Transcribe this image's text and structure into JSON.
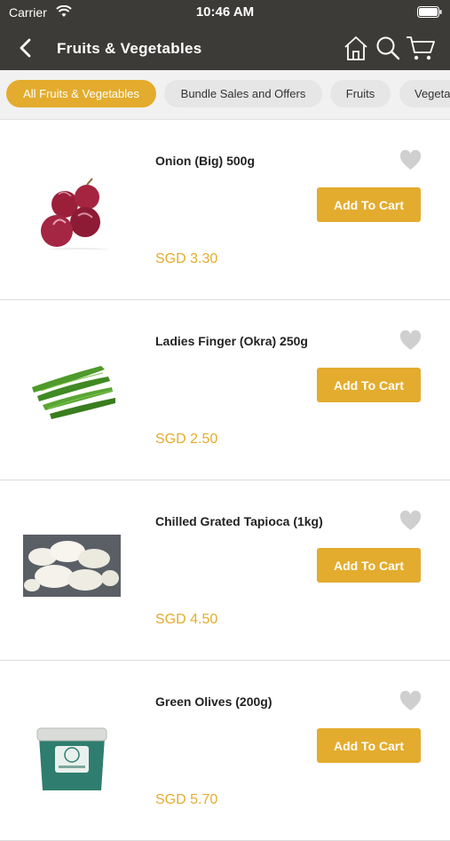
{
  "status_bar": {
    "carrier": "Carrier",
    "time": "10:46 AM"
  },
  "nav": {
    "title": "Fruits & Vegetables"
  },
  "categories": [
    {
      "label": "All Fruits & Vegetables",
      "active": true
    },
    {
      "label": "Bundle Sales and Offers",
      "active": false
    },
    {
      "label": "Fruits",
      "active": false
    },
    {
      "label": "Vegeta",
      "active": false
    }
  ],
  "products": [
    {
      "name": "Onion (Big) 500g",
      "price": "SGD 3.30",
      "button": "Add To Cart",
      "image": "onion"
    },
    {
      "name": "Ladies Finger (Okra) 250g",
      "price": "SGD 2.50",
      "button": "Add To Cart",
      "image": "okra"
    },
    {
      "name": "Chilled Grated Tapioca (1kg)",
      "price": "SGD 4.50",
      "button": "Add To Cart",
      "image": "tapioca"
    },
    {
      "name": "Green Olives (200g)",
      "price": "SGD 5.70",
      "button": "Add To Cart",
      "image": "olives-tub"
    }
  ],
  "colors": {
    "accent": "#e3ac2e",
    "header": "#3d3b38",
    "chip_bg": "#e6e6e6"
  }
}
